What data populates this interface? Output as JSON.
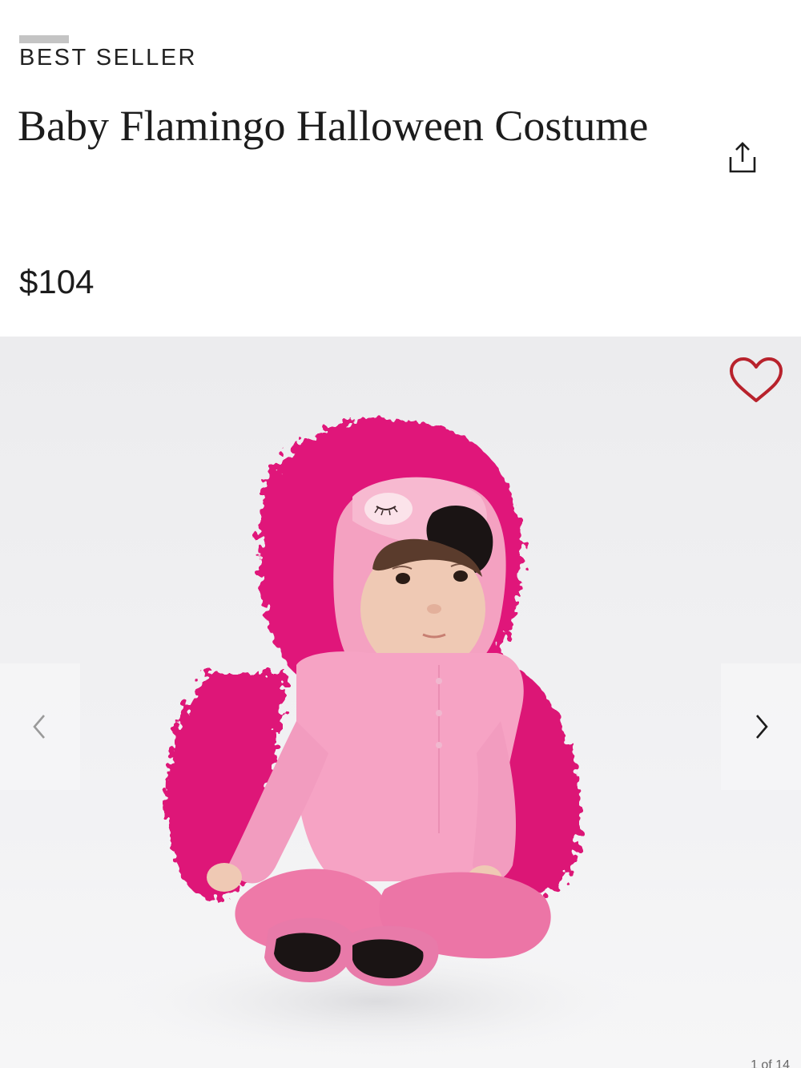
{
  "product": {
    "badge": "BEST SELLER",
    "title": "Baby Flamingo Halloween Costume",
    "price": "$104"
  },
  "actions": {
    "share_icon": "share-icon",
    "favorite_icon": "heart-outline-icon",
    "prev_icon": "chevron-left-icon",
    "next_icon": "chevron-right-icon"
  },
  "gallery": {
    "image_alt": "Baby wearing pink flamingo costume",
    "counter": "1 of 14"
  },
  "colors": {
    "favorite_heart": "#b8222c",
    "costume_fur": "#e0157a",
    "costume_body": "#f7a6c6",
    "text": "#1c1c1c"
  }
}
